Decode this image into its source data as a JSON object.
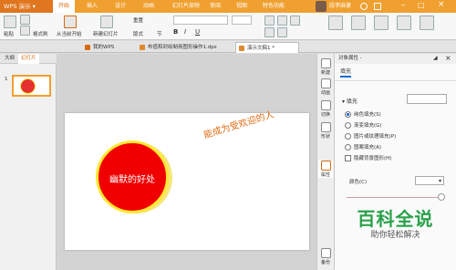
{
  "app": {
    "name": "WPS 演示"
  },
  "menu": [
    {
      "label": "开始",
      "active": true
    },
    {
      "label": "插入"
    },
    {
      "label": "设计"
    },
    {
      "label": "动画"
    },
    {
      "label": "幻灯片放映"
    },
    {
      "label": "审阅"
    },
    {
      "label": "视图"
    },
    {
      "label": "特色功能"
    }
  ],
  "user": {
    "name": "段李麻婆"
  },
  "ribbon": {
    "paste": "粘贴",
    "format_painter": "格式刷",
    "from_current": "从当前开始",
    "new_slide": "新建幻灯片",
    "reset": "重置",
    "section": "版式",
    "layout": "节"
  },
  "tabs": [
    {
      "label": "我的WPS"
    },
    {
      "label": "布值和封绘制用图形操作1.dps"
    },
    {
      "label": "演示文稿1 *",
      "active": true
    }
  ],
  "left_pane": {
    "tab_outline": "大纲",
    "tab_slides": "幻灯片",
    "slide_number": "1"
  },
  "slide": {
    "circle_text": "幽默的好处",
    "arc_text": "能成为受欢迎的人"
  },
  "right_strip": [
    {
      "label": "新建",
      "icon": "new-icon"
    },
    {
      "label": "动画",
      "icon": "animation-icon"
    },
    {
      "label": "切换",
      "icon": "transition-icon"
    },
    {
      "label": "形状",
      "icon": "shape-icon"
    },
    {
      "label": "属性",
      "icon": "property-icon"
    },
    {
      "label": "备份",
      "icon": "backup-icon"
    }
  ],
  "panel": {
    "header": "对象属性 -",
    "tab": "填充",
    "section": "填充",
    "options": [
      {
        "label": "纯色填充(S)",
        "type": "radio",
        "selected": true
      },
      {
        "label": "渐变填充(G)",
        "type": "radio"
      },
      {
        "label": "图片或纹理填充(P)",
        "type": "radio"
      },
      {
        "label": "图案填充(A)",
        "type": "radio"
      },
      {
        "label": "隐藏背景图形(H)",
        "type": "checkbox"
      }
    ],
    "color_label": "颜色(C)"
  },
  "watermark": {
    "title": "百科全说",
    "subtitle": "助你轻松解决"
  },
  "colors": {
    "accent": "#f0a030",
    "circle": "#f00000",
    "ring": "#ffe832",
    "arc_text": "#e26b14",
    "watermark": "#2aa14a"
  }
}
